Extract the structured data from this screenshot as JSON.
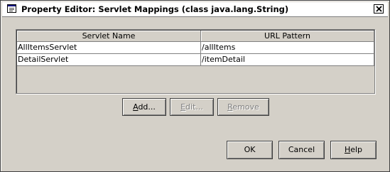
{
  "window": {
    "title": "Property Editor: Servlet Mappings (class java.lang.String)"
  },
  "table": {
    "columns": [
      "Servlet Name",
      "URL Pattern"
    ],
    "rows": [
      [
        "AllItemsServlet",
        "/allItems"
      ],
      [
        "DetailServlet",
        "/itemDetail"
      ]
    ]
  },
  "actions": {
    "add": {
      "mnemonic": "A",
      "rest": "dd..."
    },
    "edit": {
      "mnemonic": "E",
      "rest": "dit..."
    },
    "remove": {
      "mnemonic": "R",
      "rest": "emove"
    }
  },
  "dialog_buttons": {
    "ok": "OK",
    "cancel": "Cancel",
    "help": {
      "mnemonic": "H",
      "rest": "elp"
    }
  },
  "icons": {
    "window": "window-icon",
    "close": "close-icon"
  }
}
